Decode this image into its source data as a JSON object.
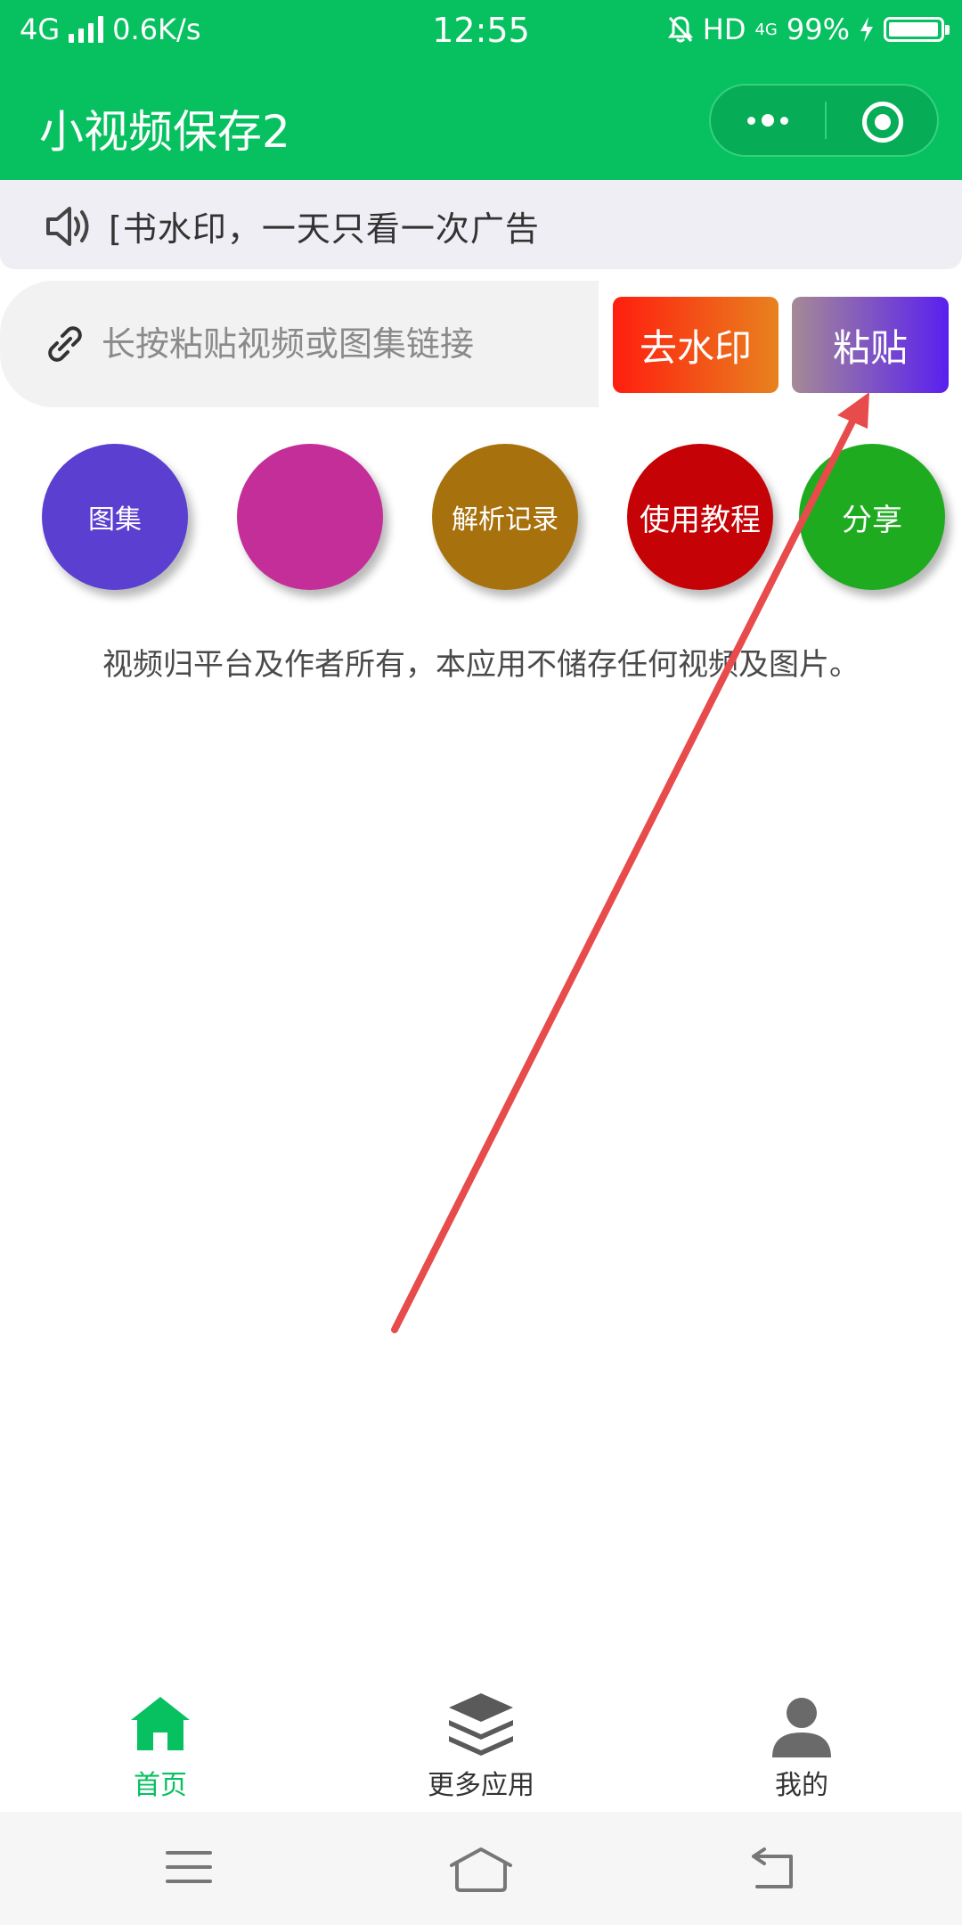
{
  "status_bar": {
    "network": "4G",
    "speed": "0.6K/s",
    "time": "12:55",
    "hd": "HD",
    "network2": "4G",
    "battery": "99%",
    "battery_level": 0.99
  },
  "header": {
    "title": "小视频保存2"
  },
  "notice": {
    "text": "[书水印，一天只看一次广告"
  },
  "input": {
    "placeholder": "长按粘贴视频或图集链接"
  },
  "buttons": {
    "remove_watermark": "去水印",
    "paste": "粘贴"
  },
  "circles": [
    {
      "label": "图集",
      "color": "#5b3fd1"
    },
    {
      "label": "",
      "color": "#c42e98"
    },
    {
      "label": "解析记录",
      "color": "#a7710d"
    },
    {
      "label": "使用教程",
      "color": "#c50205"
    },
    {
      "label": "分享",
      "color": "#1fab20"
    }
  ],
  "disclaimer": "视频归平台及作者所有，本应用不储存任何视频及图片。",
  "tabbar": {
    "items": [
      {
        "label": "首页",
        "icon": "home-icon",
        "active": true
      },
      {
        "label": "更多应用",
        "icon": "layers-icon",
        "active": false
      },
      {
        "label": "我的",
        "icon": "user-icon",
        "active": false
      }
    ]
  },
  "colors": {
    "brand": "#07c160",
    "annotation_arrow": "#e84b4b"
  }
}
